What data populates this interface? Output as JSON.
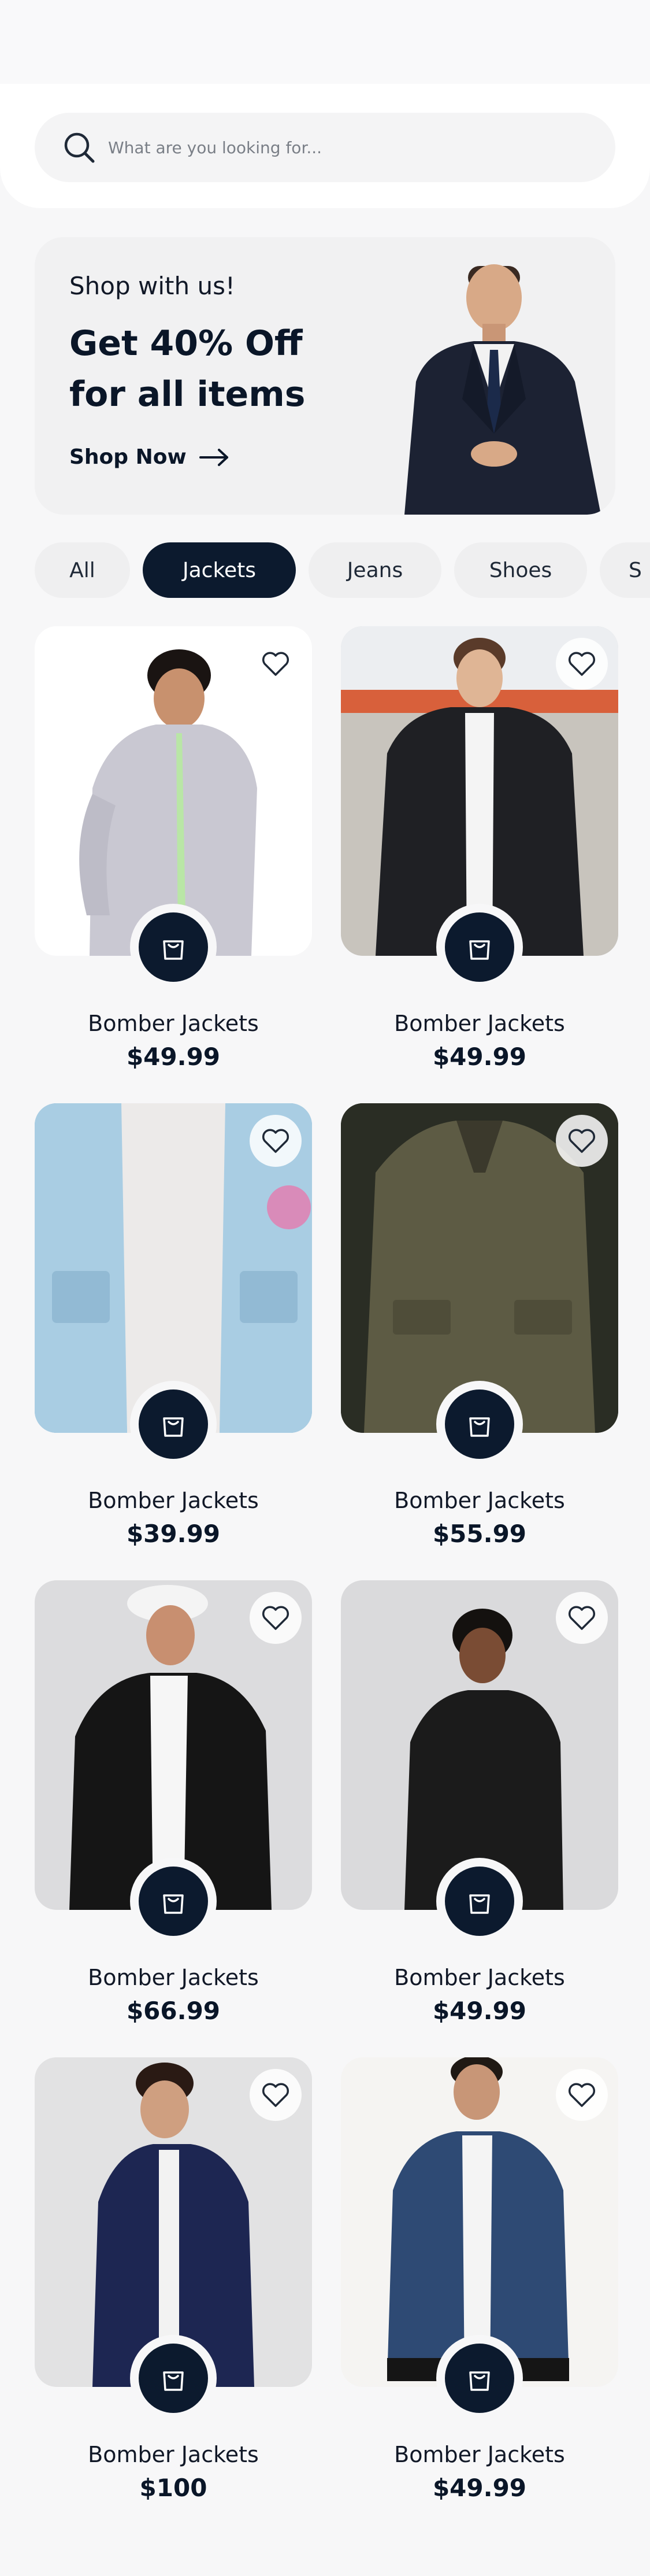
{
  "search": {
    "placeholder": "What are you looking for..."
  },
  "promo": {
    "kicker": "Shop with us!",
    "headline": "Get 40% Off for all items",
    "cta": "Shop Now"
  },
  "categories": [
    {
      "label": "All",
      "active": false
    },
    {
      "label": "Jackets",
      "active": true
    },
    {
      "label": "Jeans",
      "active": false
    },
    {
      "label": "Shoes",
      "active": false
    },
    {
      "label": "S",
      "active": false
    }
  ],
  "products": [
    {
      "name": "Bomber Jackets",
      "price": "$49.99"
    },
    {
      "name": "Bomber Jackets",
      "price": "$49.99"
    },
    {
      "name": "Bomber Jackets",
      "price": "$39.99"
    },
    {
      "name": "Bomber Jackets",
      "price": "$55.99"
    },
    {
      "name": "Bomber Jackets",
      "price": "$66.99"
    },
    {
      "name": "Bomber Jackets",
      "price": "$49.99"
    },
    {
      "name": "Bomber Jackets",
      "price": "$100"
    },
    {
      "name": "Bomber Jackets",
      "price": "$49.99"
    }
  ],
  "colors": {
    "navy": "#0c1a2e",
    "background": "#f7f7f8",
    "chip": "#efeff0"
  },
  "icons": [
    "search-icon",
    "arrow-right-icon",
    "heart-icon",
    "shopping-bag-icon"
  ]
}
